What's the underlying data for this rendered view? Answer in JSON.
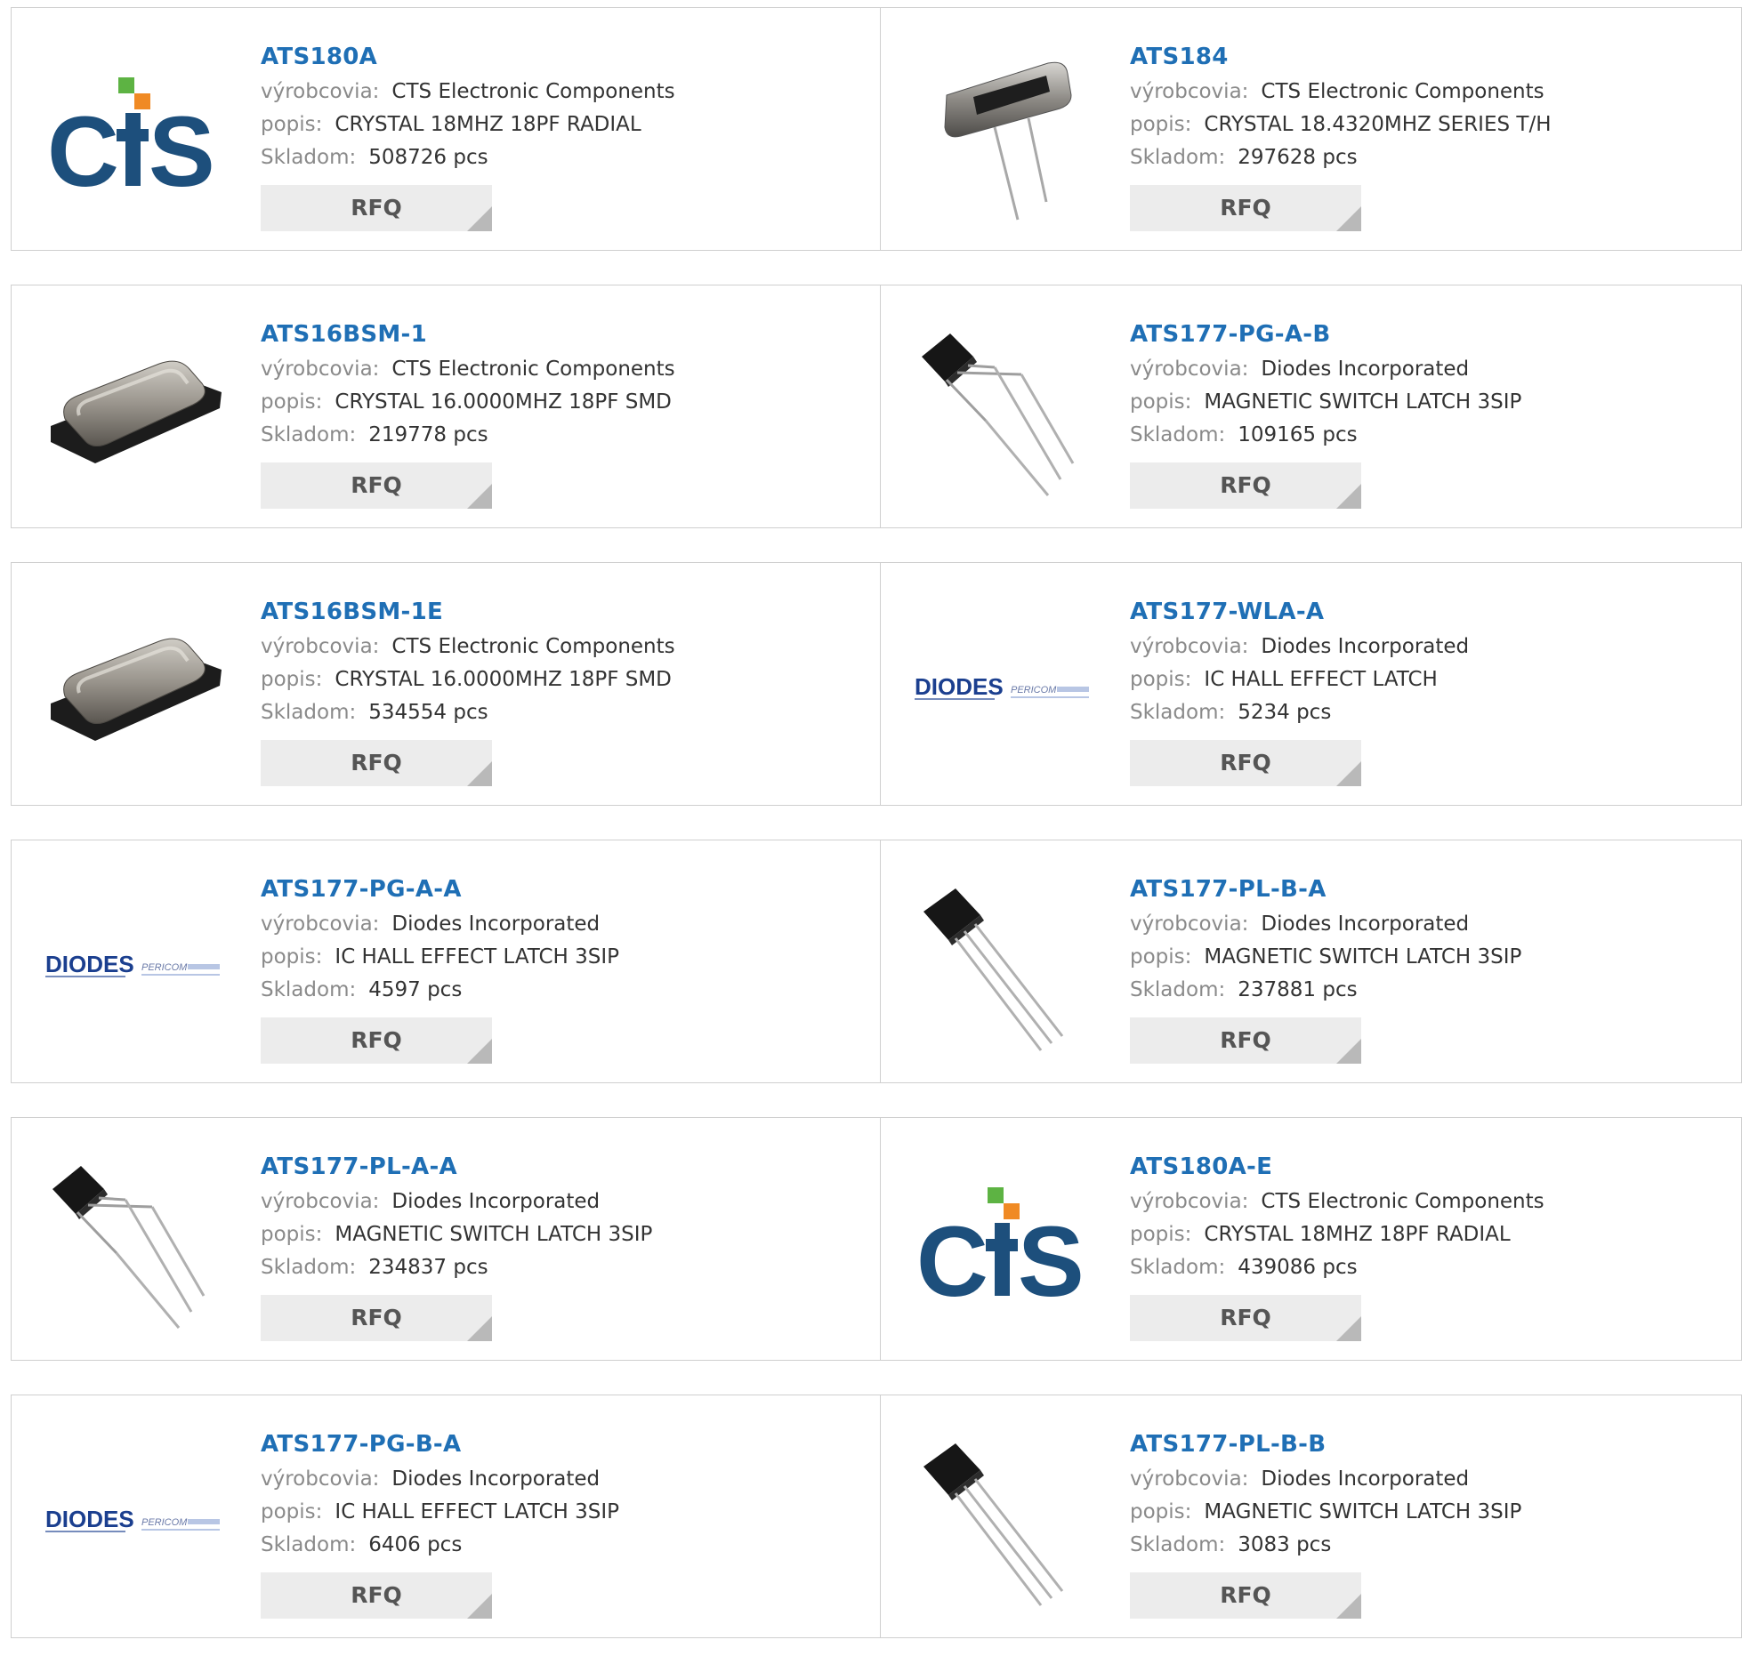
{
  "labels": {
    "manufacturer": "výrobcovia:",
    "description": "popis:",
    "stock": "Skladom:"
  },
  "products": [
    {
      "part": "ATS180A",
      "manufacturer": "CTS Electronic Components",
      "description": "CRYSTAL 18MHZ 18PF RADIAL",
      "stock": "508726 pcs",
      "image": "cts-logo",
      "rfq": "RFQ"
    },
    {
      "part": "ATS184",
      "manufacturer": "CTS Electronic Components",
      "description": "CRYSTAL 18.4320MHZ SERIES T/H",
      "stock": "297628 pcs",
      "image": "crystal-radial",
      "rfq": "RFQ"
    },
    {
      "part": "ATS16BSM-1",
      "manufacturer": "CTS Electronic Components",
      "description": "CRYSTAL 16.0000MHZ 18PF SMD",
      "stock": "219778 pcs",
      "image": "crystal-smd",
      "rfq": "RFQ"
    },
    {
      "part": "ATS177-PG-A-B",
      "manufacturer": "Diodes Incorporated",
      "description": "MAGNETIC SWITCH LATCH 3SIP",
      "stock": "109165 pcs",
      "image": "hall-bent",
      "rfq": "RFQ"
    },
    {
      "part": "ATS16BSM-1E",
      "manufacturer": "CTS Electronic Components",
      "description": "CRYSTAL 16.0000MHZ 18PF SMD",
      "stock": "534554 pcs",
      "image": "crystal-smd",
      "rfq": "RFQ"
    },
    {
      "part": "ATS177-WLA-A",
      "manufacturer": "Diodes Incorporated",
      "description": "IC HALL EFFECT LATCH",
      "stock": "5234 pcs",
      "image": "diodes-logo",
      "rfq": "RFQ"
    },
    {
      "part": "ATS177-PG-A-A",
      "manufacturer": "Diodes Incorporated",
      "description": "IC HALL EFFECT LATCH 3SIP",
      "stock": "4597 pcs",
      "image": "diodes-logo",
      "rfq": "RFQ"
    },
    {
      "part": "ATS177-PL-B-A",
      "manufacturer": "Diodes Incorporated",
      "description": "MAGNETIC SWITCH LATCH 3SIP",
      "stock": "237881 pcs",
      "image": "hall-straight",
      "rfq": "RFQ"
    },
    {
      "part": "ATS177-PL-A-A",
      "manufacturer": "Diodes Incorporated",
      "description": "MAGNETIC SWITCH LATCH 3SIP",
      "stock": "234837 pcs",
      "image": "hall-bent",
      "rfq": "RFQ"
    },
    {
      "part": "ATS180A-E",
      "manufacturer": "CTS Electronic Components",
      "description": "CRYSTAL 18MHZ 18PF RADIAL",
      "stock": "439086 pcs",
      "image": "cts-logo",
      "rfq": "RFQ"
    },
    {
      "part": "ATS177-PG-B-A",
      "manufacturer": "Diodes Incorporated",
      "description": "IC HALL EFFECT LATCH 3SIP",
      "stock": "6406 pcs",
      "image": "diodes-logo",
      "rfq": "RFQ"
    },
    {
      "part": "ATS177-PL-B-B",
      "manufacturer": "Diodes Incorporated",
      "description": "MAGNETIC SWITCH LATCH 3SIP",
      "stock": "3083 pcs",
      "image": "hall-straight",
      "rfq": "RFQ"
    }
  ],
  "logos": {
    "cts": {
      "text_c": "C",
      "text_ts": "TS"
    },
    "diodes": {
      "main": "DIODES",
      "sub": "PERICOM"
    }
  },
  "colors": {
    "link": "#1f6fb5",
    "cts_blue": "#1d4f7c",
    "cts_green": "#5db343",
    "cts_orange": "#f08a24",
    "diodes_blue": "#1b3f8f",
    "rfq_bg": "#ececec"
  }
}
